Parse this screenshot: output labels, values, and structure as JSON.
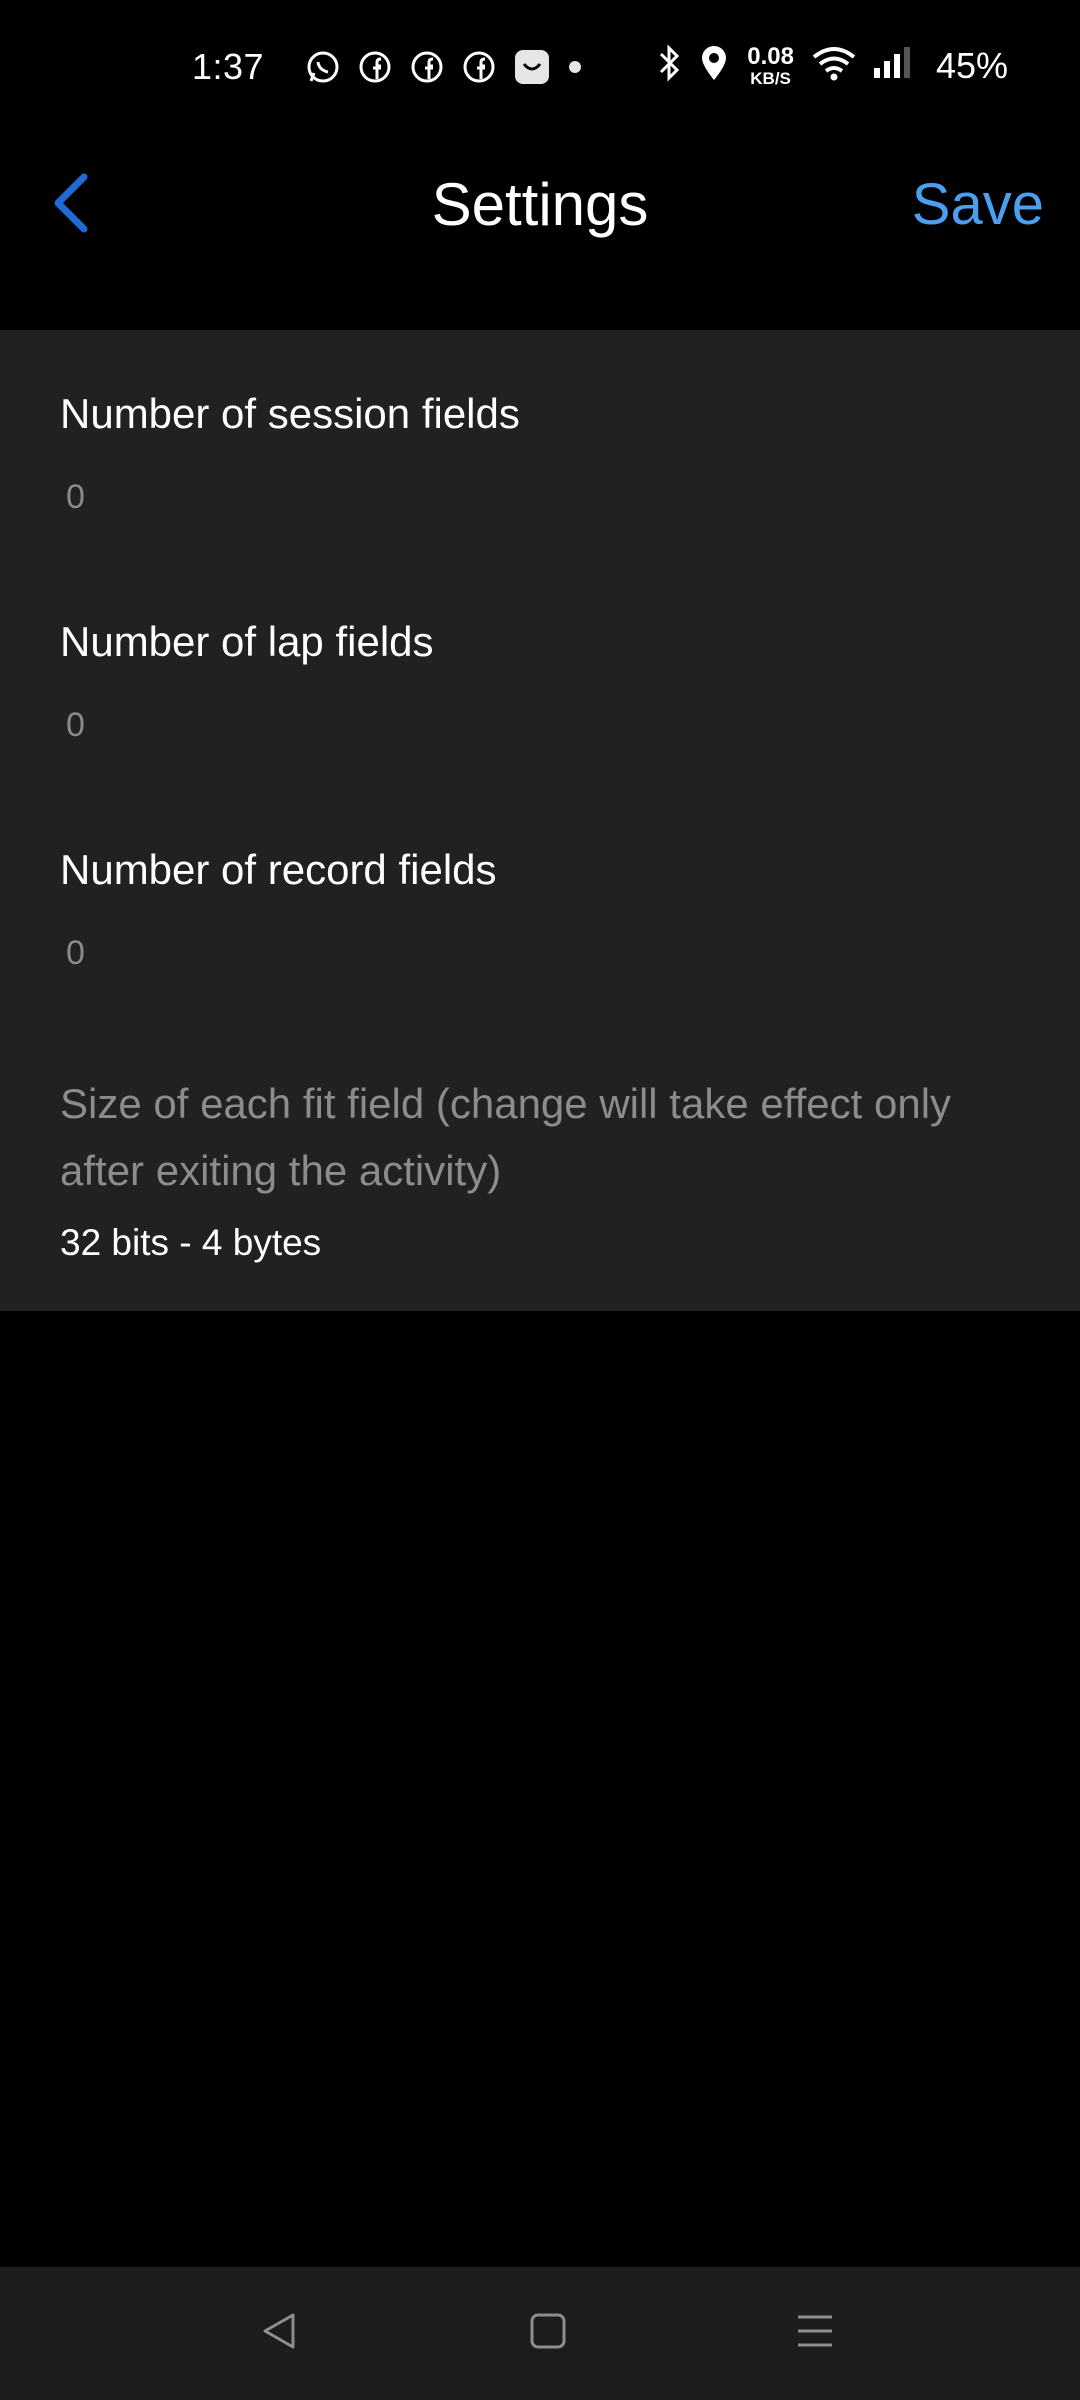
{
  "status_bar": {
    "time": "1:37",
    "net_speed_value": "0.08",
    "net_speed_unit": "KB/S",
    "battery": "45%",
    "notification_icons": [
      "whatsapp-icon",
      "facebook-icon",
      "facebook-icon",
      "facebook-icon",
      "shop-bag-icon",
      "dot-icon"
    ],
    "system_icons": [
      "bluetooth-icon",
      "location-icon",
      "wifi-icon",
      "signal-icon"
    ]
  },
  "toolbar": {
    "back_icon": "chevron-left-icon",
    "title": "Settings",
    "save_label": "Save"
  },
  "settings": {
    "session": {
      "label": "Number of session fields",
      "value": "0"
    },
    "lap": {
      "label": "Number of lap fields",
      "value": "0"
    },
    "record": {
      "label": "Number of record fields",
      "value": "0"
    },
    "field_size": {
      "description": "Size of each fit field (change will take effect only after exiting the activity)",
      "value": "32 bits - 4 bytes"
    }
  },
  "nav_bar": {
    "icons": [
      "back-triangle-icon",
      "home-square-icon",
      "menu-lines-icon"
    ]
  },
  "colors": {
    "accent": "#4a9ff0",
    "back_chevron": "#1e6bd6",
    "panel_bg": "#212121",
    "page_bg": "#000000"
  }
}
